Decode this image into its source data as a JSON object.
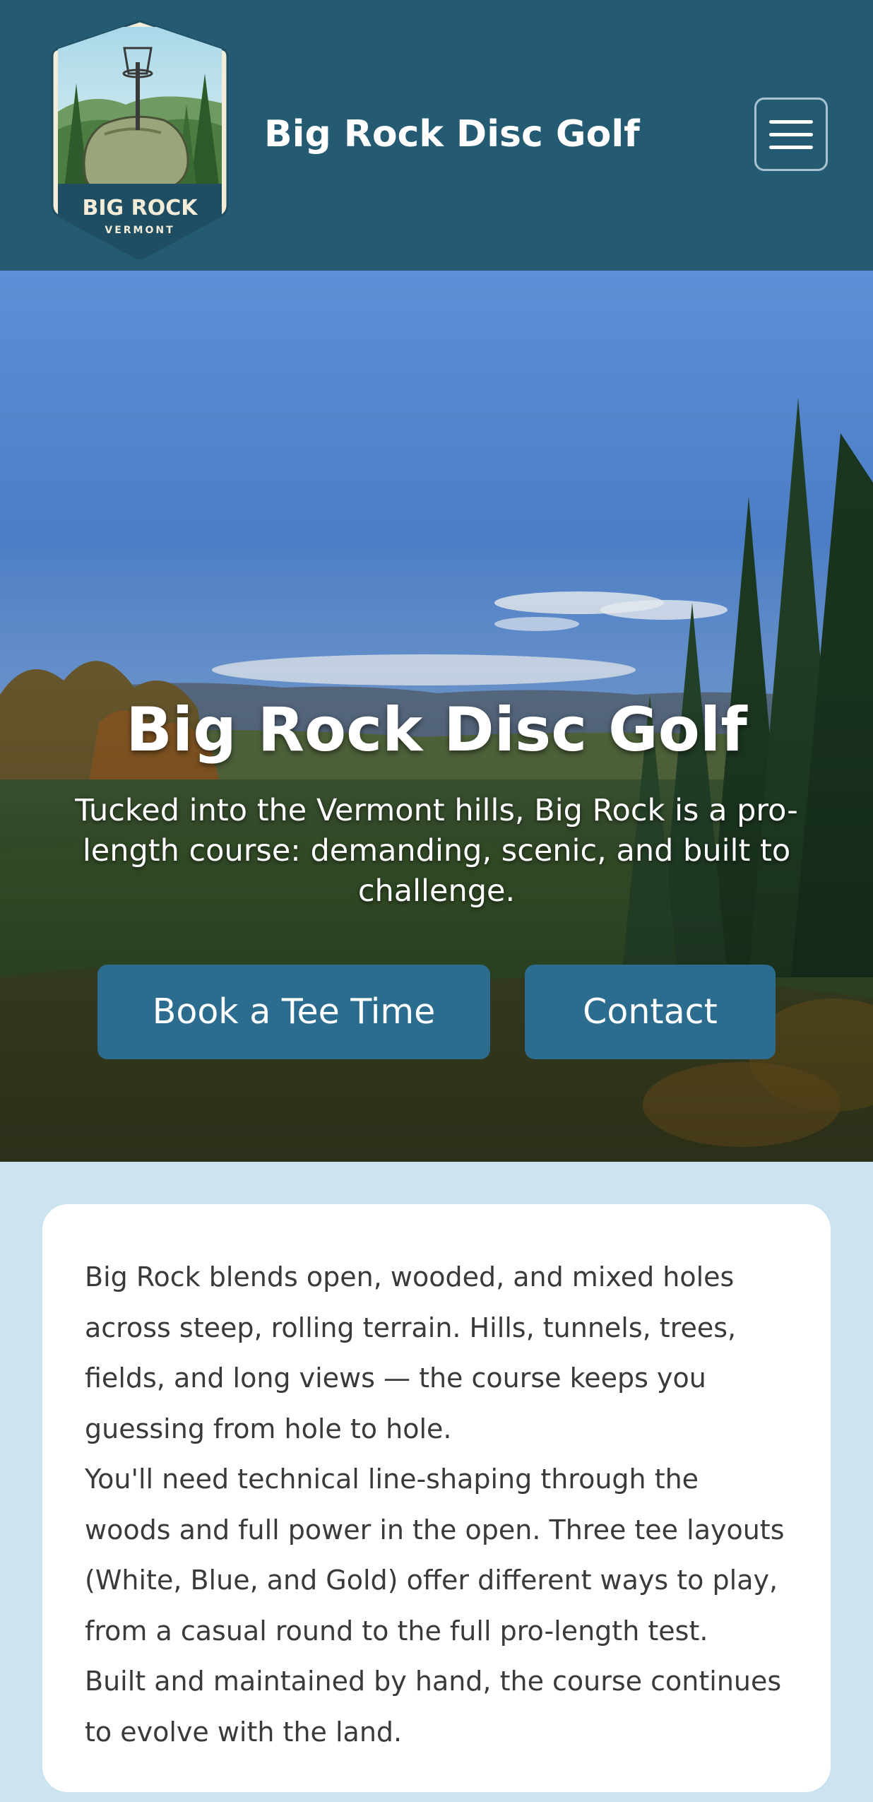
{
  "header": {
    "logo_text": "BIG ROCK",
    "logo_subtext": "VERMONT",
    "site_title": "Big Rock Disc Golf",
    "menu_icon": "hamburger-icon"
  },
  "hero": {
    "title": "Big Rock Disc Golf",
    "subtitle": "Tucked into the Vermont hills, Big Rock is a pro-length course: demanding, scenic, and built to challenge.",
    "buttons": [
      {
        "label": "Book a Tee Time"
      },
      {
        "label": "Contact"
      }
    ]
  },
  "intro": {
    "paragraphs": [
      "Big Rock blends open, wooded, and mixed holes across steep, rolling terrain. Hills, tunnels, trees, fields, and long views — the course keeps you guessing from hole to hole.",
      "You'll need technical line-shaping through the woods and full power in the open. Three tee layouts (White, Blue, and Gold) offer different ways to play, from a casual round to the full pro-length test.",
      "Built and maintained by hand, the course continues to evolve with the land."
    ]
  },
  "colors": {
    "header_bg": "#245a72",
    "button_bg": "#2b6c8f",
    "page_bg": "#cbe4f0",
    "card_bg": "#ffffff"
  }
}
